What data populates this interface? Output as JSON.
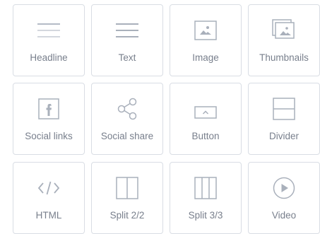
{
  "blocks": [
    {
      "label": "Headline",
      "icon": "headline-lines-icon"
    },
    {
      "label": "Text",
      "icon": "text-lines-icon"
    },
    {
      "label": "Image",
      "icon": "image-icon"
    },
    {
      "label": "Thumbnails",
      "icon": "thumbnails-icon"
    },
    {
      "label": "Social links",
      "icon": "facebook-icon"
    },
    {
      "label": "Social share",
      "icon": "share-icon"
    },
    {
      "label": "Button",
      "icon": "button-icon"
    },
    {
      "label": "Divider",
      "icon": "divider-icon"
    },
    {
      "label": "HTML",
      "icon": "code-icon"
    },
    {
      "label": "Split 2/2",
      "icon": "split-two-columns-icon"
    },
    {
      "label": "Split 3/3",
      "icon": "split-three-columns-icon"
    },
    {
      "label": "Video",
      "icon": "play-icon"
    }
  ],
  "colors": {
    "border": "#d9dde4",
    "icon_stroke": "#a9b0bb",
    "label_text": "#787f8c",
    "background": "#ffffff"
  }
}
